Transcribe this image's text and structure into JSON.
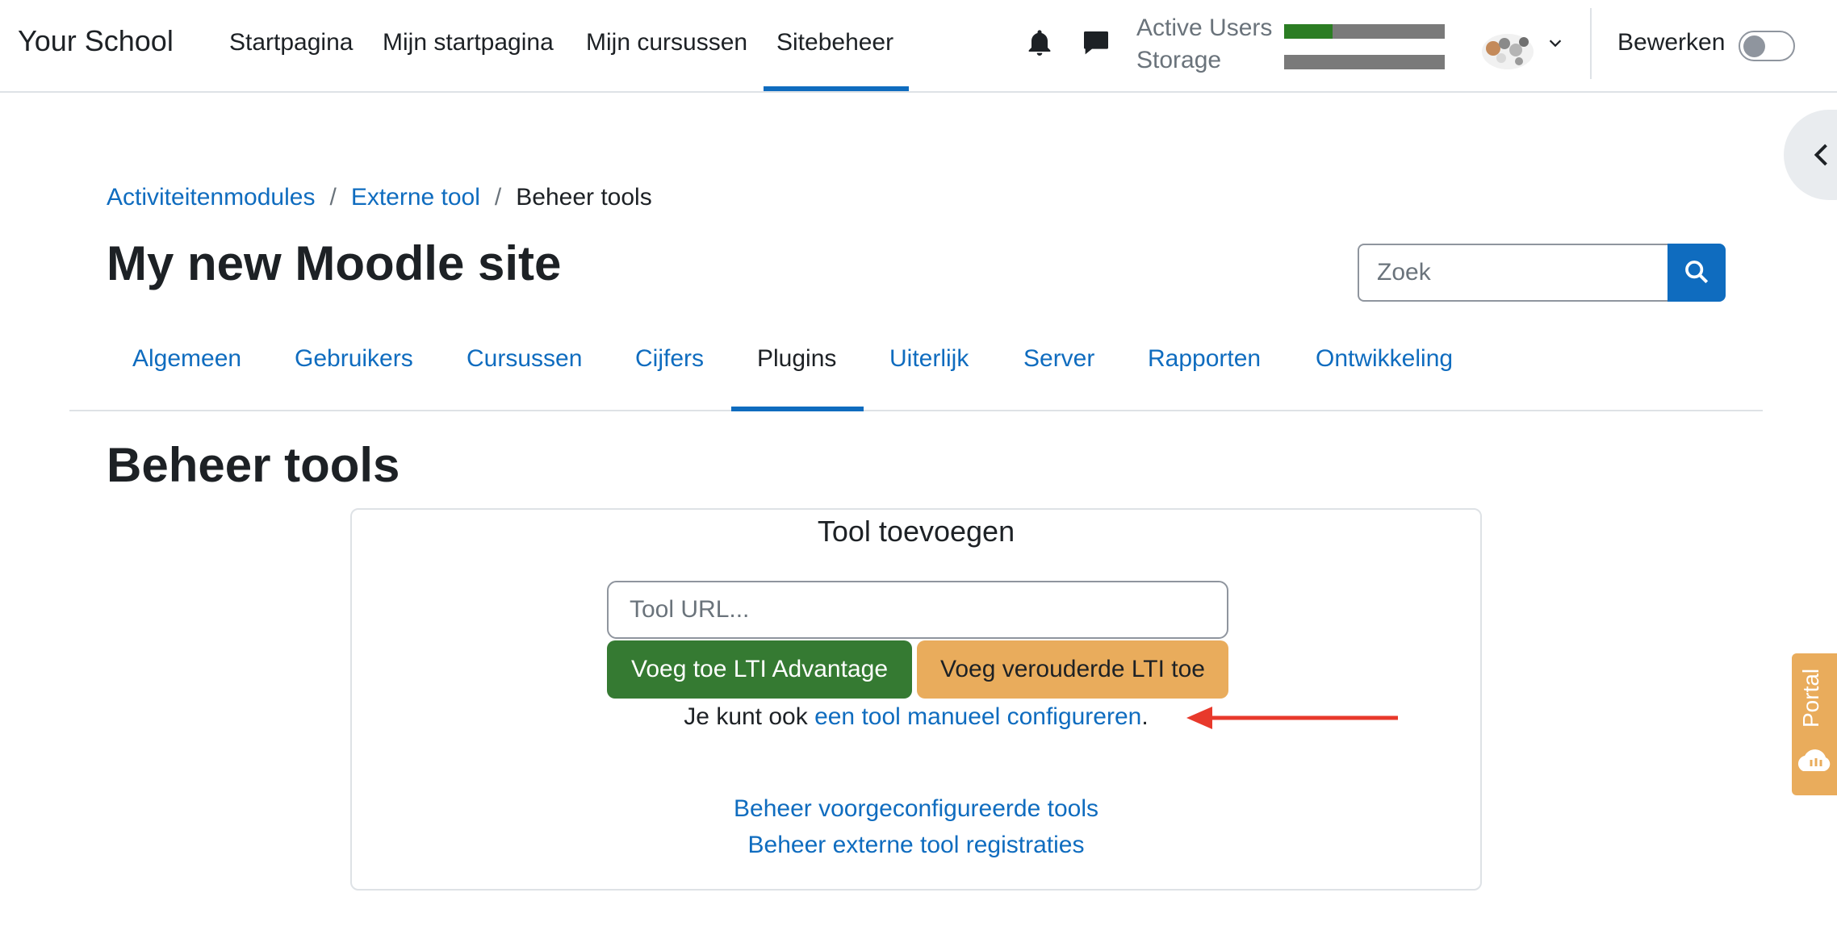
{
  "app": {
    "brand": "Your School",
    "primary_nav": [
      "Startpagina",
      "Mijn startpagina",
      "Mijn cursussen",
      "Sitebeheer"
    ],
    "active_nav": "Sitebeheer"
  },
  "usage": {
    "active_users_label": "Active Users",
    "active_users_fraction": 0.3,
    "storage_label": "Storage",
    "storage_fraction": 0
  },
  "header": {
    "edit_mode_label": "Bewerken",
    "edit_mode_on": false
  },
  "breadcrumb": {
    "items": [
      "Activiteitenmodules",
      "Externe tool"
    ],
    "current": "Beheer tools"
  },
  "site": {
    "title": "My new Moodle site"
  },
  "search": {
    "placeholder": "Zoek"
  },
  "tabs": {
    "items": [
      "Algemeen",
      "Gebruikers",
      "Cursussen",
      "Cijfers",
      "Plugins",
      "Uiterlijk",
      "Server",
      "Rapporten",
      "Ontwikkeling"
    ],
    "active": "Plugins"
  },
  "page": {
    "heading": "Beheer tools"
  },
  "card": {
    "title": "Tool toevoegen",
    "tool_url_placeholder": "Tool URL...",
    "btn_lti_advantage": "Voeg toe LTI Advantage",
    "btn_legacy_lti": "Voeg verouderde LTI toe",
    "manual_prefix": "Je kunt ook ",
    "manual_link": "een tool manueel configureren",
    "manual_suffix": ".",
    "link_preconfigured": "Beheer voorgeconfigureerde tools",
    "link_registrations": "Beheer externe tool registraties"
  },
  "portal": {
    "label": "Portal"
  },
  "colors": {
    "accent": "#0f6cbf",
    "green_button": "#357a32",
    "orange_button": "#e9ac5c",
    "arrow": "#e8392b"
  }
}
